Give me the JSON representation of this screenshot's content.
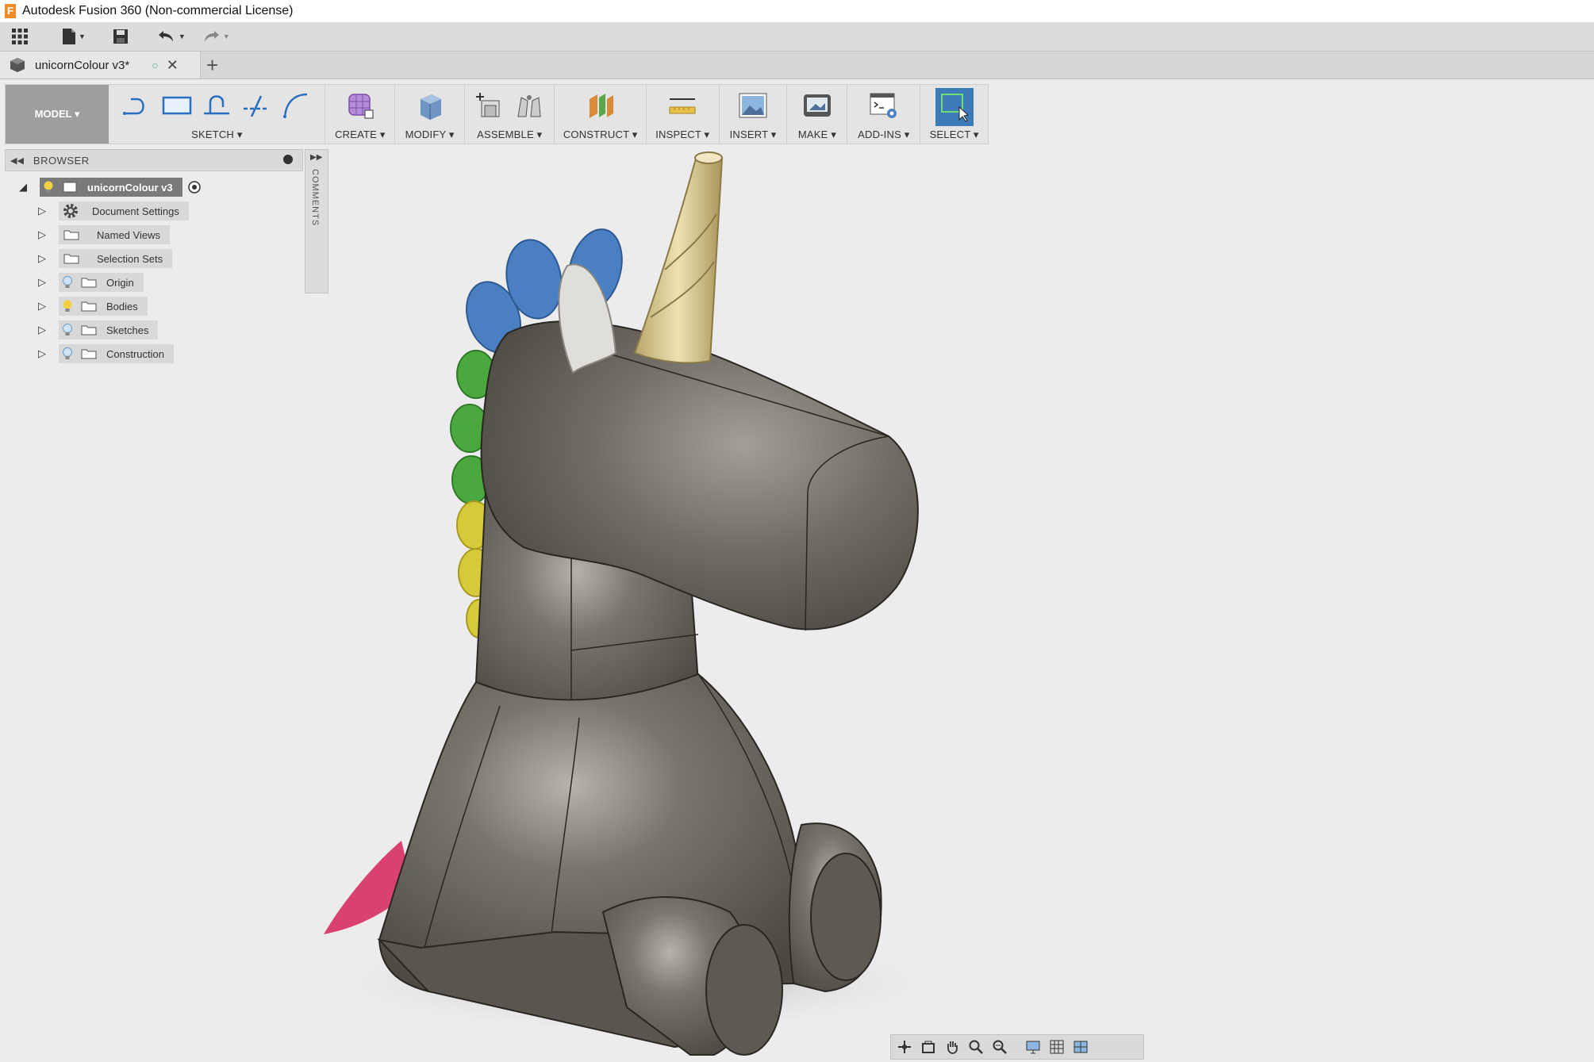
{
  "window": {
    "title": "Autodesk Fusion 360 (Non-commercial License)"
  },
  "quick_access": {
    "icons": [
      "apps-grid-icon",
      "file-icon",
      "save-icon",
      "undo-icon",
      "redo-icon"
    ]
  },
  "document_tab": {
    "name": "unicornColour v3*",
    "new_tab": "+",
    "close": "✕"
  },
  "ribbon": {
    "workspace": "MODEL ▾",
    "groups": {
      "sketch": "SKETCH ▾",
      "create": "CREATE ▾",
      "modify": "MODIFY ▾",
      "assemble": "ASSEMBLE ▾",
      "construct": "CONSTRUCT ▾",
      "inspect": "INSPECT ▾",
      "insert": "INSERT ▾",
      "make": "MAKE ▾",
      "addins": "ADD-INS ▾",
      "select": "SELECT ▾"
    }
  },
  "browser": {
    "header": "BROWSER",
    "root": "unicornColour v3",
    "items": [
      {
        "label": "Document Settings",
        "icon": "gear-icon"
      },
      {
        "label": "Named Views",
        "icon": "folder-icon"
      },
      {
        "label": "Selection Sets",
        "icon": "folder-icon"
      },
      {
        "label": "Origin",
        "icon": "folder-icon"
      },
      {
        "label": "Bodies",
        "icon": "folder-icon"
      },
      {
        "label": "Sketches",
        "icon": "folder-icon"
      },
      {
        "label": "Construction",
        "icon": "folder-icon"
      }
    ]
  },
  "comments": {
    "label": "COMMENTS"
  },
  "colors": {
    "body": "#6b665f",
    "horn": "#d7c58b",
    "mane_blue": "#4a7fc1",
    "mane_green": "#4aa83f",
    "mane_yellow": "#d6c93a",
    "tail": "#d9416e",
    "ear": "#e0ded8",
    "select_blue": "#3d7ab8"
  }
}
